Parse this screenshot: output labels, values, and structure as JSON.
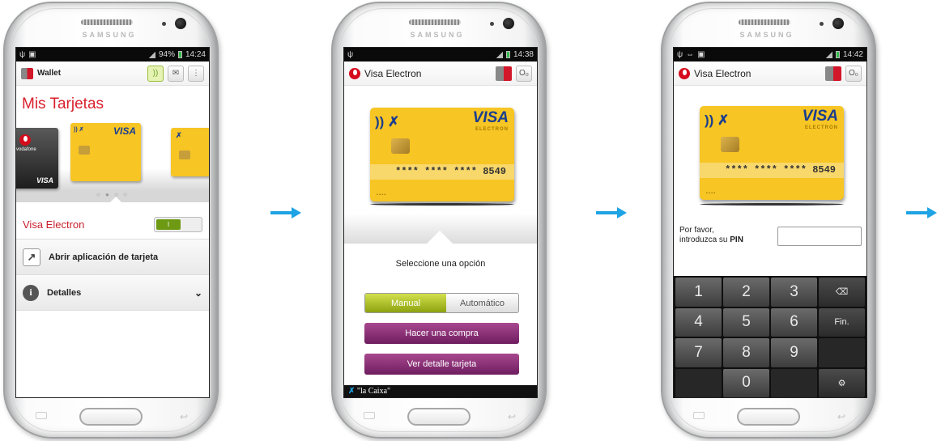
{
  "phone_brand": "SAMSUNG",
  "colors": {
    "accent_arrow": "#1ea3e4",
    "card_yellow": "#f7c524",
    "red": "#d91f2c",
    "purple": "#8a2e77",
    "green": "#8da210"
  },
  "screen1": {
    "status_time": "14:24",
    "status_battery": "94%",
    "app_title": "Wallet",
    "heading": "Mis Tarjetas",
    "card_brand": "VISA",
    "card_sub": "vodafone",
    "selected_card": "Visa Electron",
    "toggle_label": "I",
    "open_app": "Abrir aplicación de tarjeta",
    "details": "Detalles",
    "dots": "○ ● ○ ○"
  },
  "screen2": {
    "status_time": "14:38",
    "title": "Visa Electron",
    "card_brand": "VISA",
    "card_sub": "ELECTRON",
    "card_number": "**** **** **** 8549",
    "prompt": "Seleccione una opción",
    "seg_manual": "Manual",
    "seg_auto": "Automático",
    "btn_buy": "Hacer una compra",
    "btn_detail": "Ver detalle tarjeta",
    "footer_brand": "\"la Caixa\""
  },
  "screen3": {
    "status_time": "14:42",
    "title": "Visa Electron",
    "card_brand": "VISA",
    "card_sub": "ELECTRON",
    "card_number": "**** **** **** 8549",
    "pin_line1": "Por favor,",
    "pin_line2": "introduzca su ",
    "pin_bold": "PIN",
    "keys": [
      "1",
      "2",
      "3",
      "⌫",
      "4",
      "5",
      "6",
      "Fin.",
      "7",
      "8",
      "9",
      "",
      "",
      "0",
      "",
      "⚙"
    ]
  }
}
